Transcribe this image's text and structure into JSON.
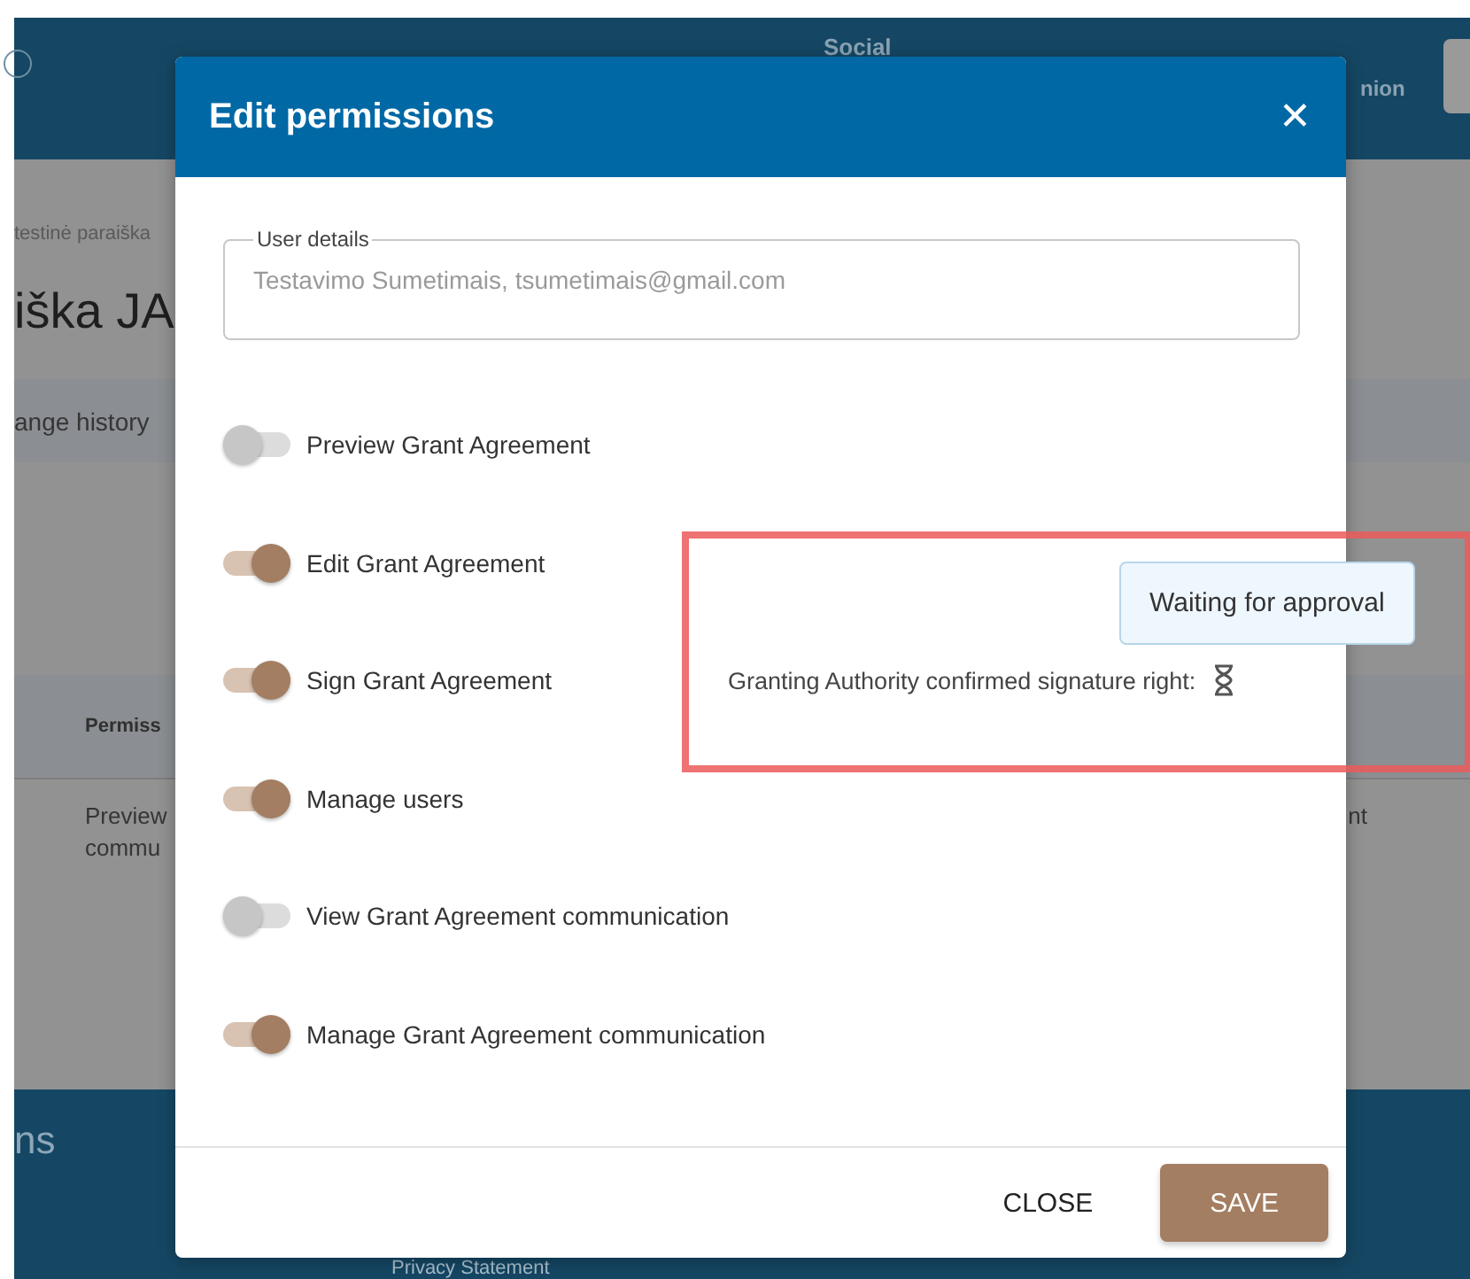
{
  "background": {
    "header": {
      "items": [
        "Social",
        "nion"
      ]
    },
    "breadcrumb": "testinė paraiška",
    "page_title": "iška JA",
    "tab": "ange history",
    "table": {
      "column_1": "Permiss",
      "row_1": {
        "cell_1": "Preview\ncommu",
        "cell_2": "nt"
      }
    },
    "footer": {
      "heading": "ns",
      "link": "Privacy Statement"
    }
  },
  "modal": {
    "title": "Edit permissions",
    "close_icon": "✕",
    "user_details": {
      "label": "User details",
      "value": "Testavimo Sumetimais, tsumetimais@gmail.com",
      "disabled": true
    },
    "permissions": [
      {
        "label": "Preview Grant Agreement",
        "on": false
      },
      {
        "label": "Edit Grant Agreement",
        "on": true
      },
      {
        "label": "Sign Grant Agreement",
        "on": true,
        "note": "Granting Authority confirmed signature right:"
      },
      {
        "label": "Manage users",
        "on": true
      },
      {
        "label": "View Grant Agreement communication",
        "on": false
      },
      {
        "label": "Manage Grant Agreement communication",
        "on": true
      }
    ],
    "tooltip": "Waiting for approval",
    "buttons": [
      {
        "label": "CLOSE",
        "kind": "text"
      },
      {
        "label": "SAVE",
        "kind": "primary"
      }
    ]
  }
}
